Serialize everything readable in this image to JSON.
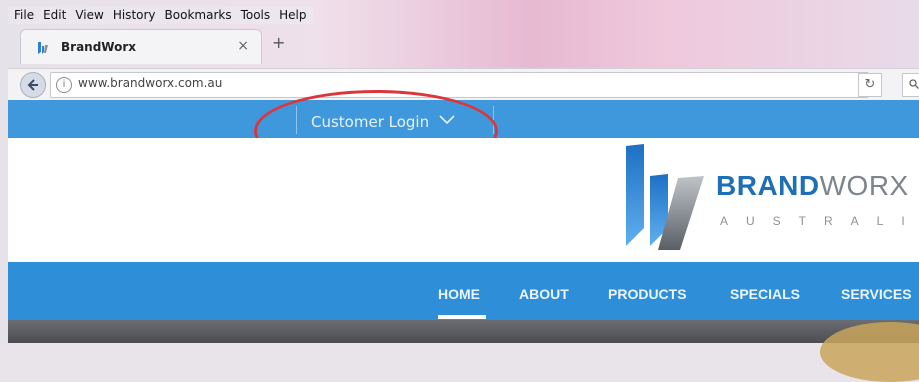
{
  "menubar": {
    "items": [
      "File",
      "Edit",
      "View",
      "History",
      "Bookmarks",
      "Tools",
      "Help"
    ]
  },
  "tab": {
    "title": "BrandWorx",
    "close": "×",
    "new_tab": "+"
  },
  "address": {
    "url": "www.brandworx.com.au"
  },
  "page": {
    "customer_login": "Customer Login",
    "brand_bold": "BRAND",
    "brand_light": "WORX",
    "brand_sub": "AUSTRALIA",
    "nav": [
      "HOME",
      "ABOUT",
      "PRODUCTS",
      "SPECIALS",
      "SERVICES"
    ]
  },
  "colors": {
    "accent_blue": "#2e8fd8",
    "highlight_red": "#d9373c",
    "brand_blue": "#1f6fb7"
  }
}
